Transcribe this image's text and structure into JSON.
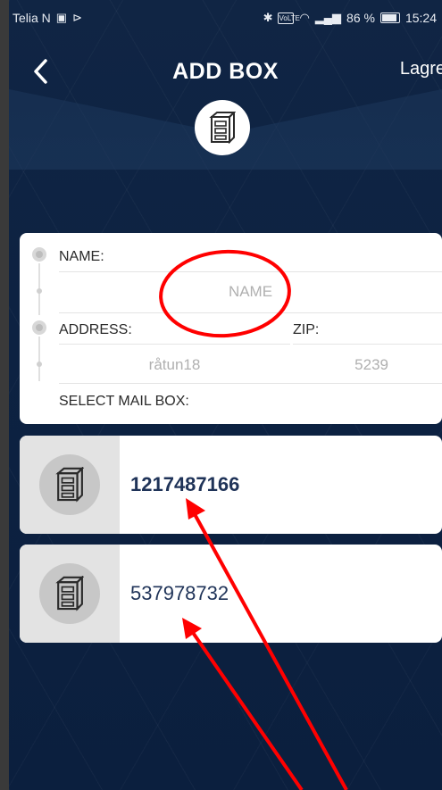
{
  "status_bar": {
    "carrier": "Telia N",
    "battery_percent": "86 %",
    "time": "15:24",
    "volte": "VoLTE",
    "icons": [
      "facebook-icon",
      "play-icon",
      "bluetooth-icon",
      "volte-icon",
      "wifi-icon",
      "signal-icon",
      "battery-icon"
    ]
  },
  "header": {
    "title": "ADD BOX",
    "save_label": "Lagre",
    "back_icon": "chevron-left-icon",
    "logo_icon": "mailbox-icon"
  },
  "form": {
    "name_label": "NAME:",
    "name_placeholder": "NAME",
    "address_label": "ADDRESS:",
    "address_value": "råtun18",
    "zip_label": "ZIP:",
    "zip_value": "5239",
    "select_label": "SELECT MAIL BOX:"
  },
  "mailboxes": [
    {
      "number": "1217487166",
      "selected": true
    },
    {
      "number": "537978732",
      "selected": false
    }
  ],
  "colors": {
    "background": "#0d2242",
    "accent_text": "#1f3358",
    "annotation": "#ff0000"
  }
}
